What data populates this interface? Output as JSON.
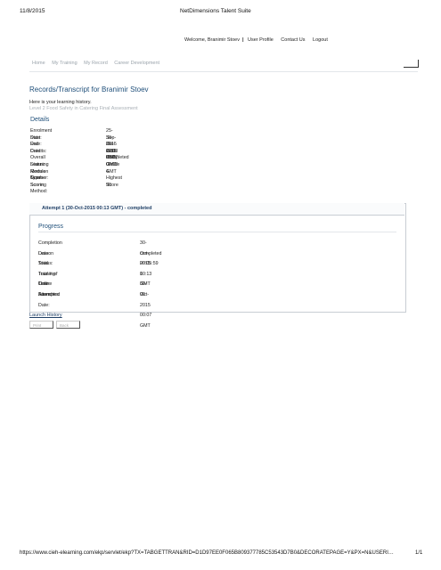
{
  "print_header": {
    "date": "11/8/2015",
    "title": "NetDimensions Talent Suite"
  },
  "top_nav": {
    "welcome": "Welcome, Branimir Stoev",
    "profile": "User Profile",
    "contact": "Contact Us",
    "logout": "Logout"
  },
  "main_nav": [
    "Home",
    "My Training",
    "My Record",
    "Career Development"
  ],
  "page_title": "Records/Transcript for Branimir Stoev",
  "intro": "Here is your learning history.",
  "course_title": "Level 2 Food Safety in Catering Final Assessment",
  "details_title": "Details",
  "details": [
    {
      "label": "Enrolment Date:",
      "value": "25-Sep-2015 12:38 BST"
    },
    {
      "label": "Start Date:",
      "value": "30-Oct-2015 00:07 GMT"
    },
    {
      "label": "End Date:",
      "value": "30-Oct-2015 00:13 GMT"
    },
    {
      "label": "Credits:",
      "value": "0.00"
    },
    {
      "label": "Overall Status:",
      "value": "Completed"
    },
    {
      "label": "Learning Module Type:",
      "value": "Online"
    },
    {
      "label": "Revision Number:",
      "value": "4"
    },
    {
      "label": "Course Scoring Method:",
      "value": "Highest Score"
    },
    {
      "label": "Score:",
      "value": "90"
    }
  ],
  "attempt": {
    "header": "Attempt 1   (30-Oct-2015 00:13 GMT) - completed",
    "progress_title": "Progress",
    "rows": [
      {
        "label": "Completion Date:",
        "value": "30-Oct-2015 00:13 GMT"
      },
      {
        "label": "Lesson Status:",
        "value": "completed"
      },
      {
        "label": "Total Training Time:",
        "value": "00:05:59"
      },
      {
        "label": "Total # of Online Launches:",
        "value": "1"
      },
      {
        "label": "Last Attempted Date:",
        "value": "30-Oct-2015 00:07 GMT"
      },
      {
        "label": "Score:",
        "value": "90"
      }
    ]
  },
  "launch_history": "Launch History",
  "buttons": {
    "print": "Print",
    "back": "Back"
  },
  "footer": {
    "url": "https://www.cieh-elearning.com/ekp/servlet/ekp?TX=TABGETTRAN&RID=D1D97EE0F065B809377785C53543D7B0&DECORATEPAGE=Y&PX=N&USERI…",
    "page": "1/1"
  }
}
